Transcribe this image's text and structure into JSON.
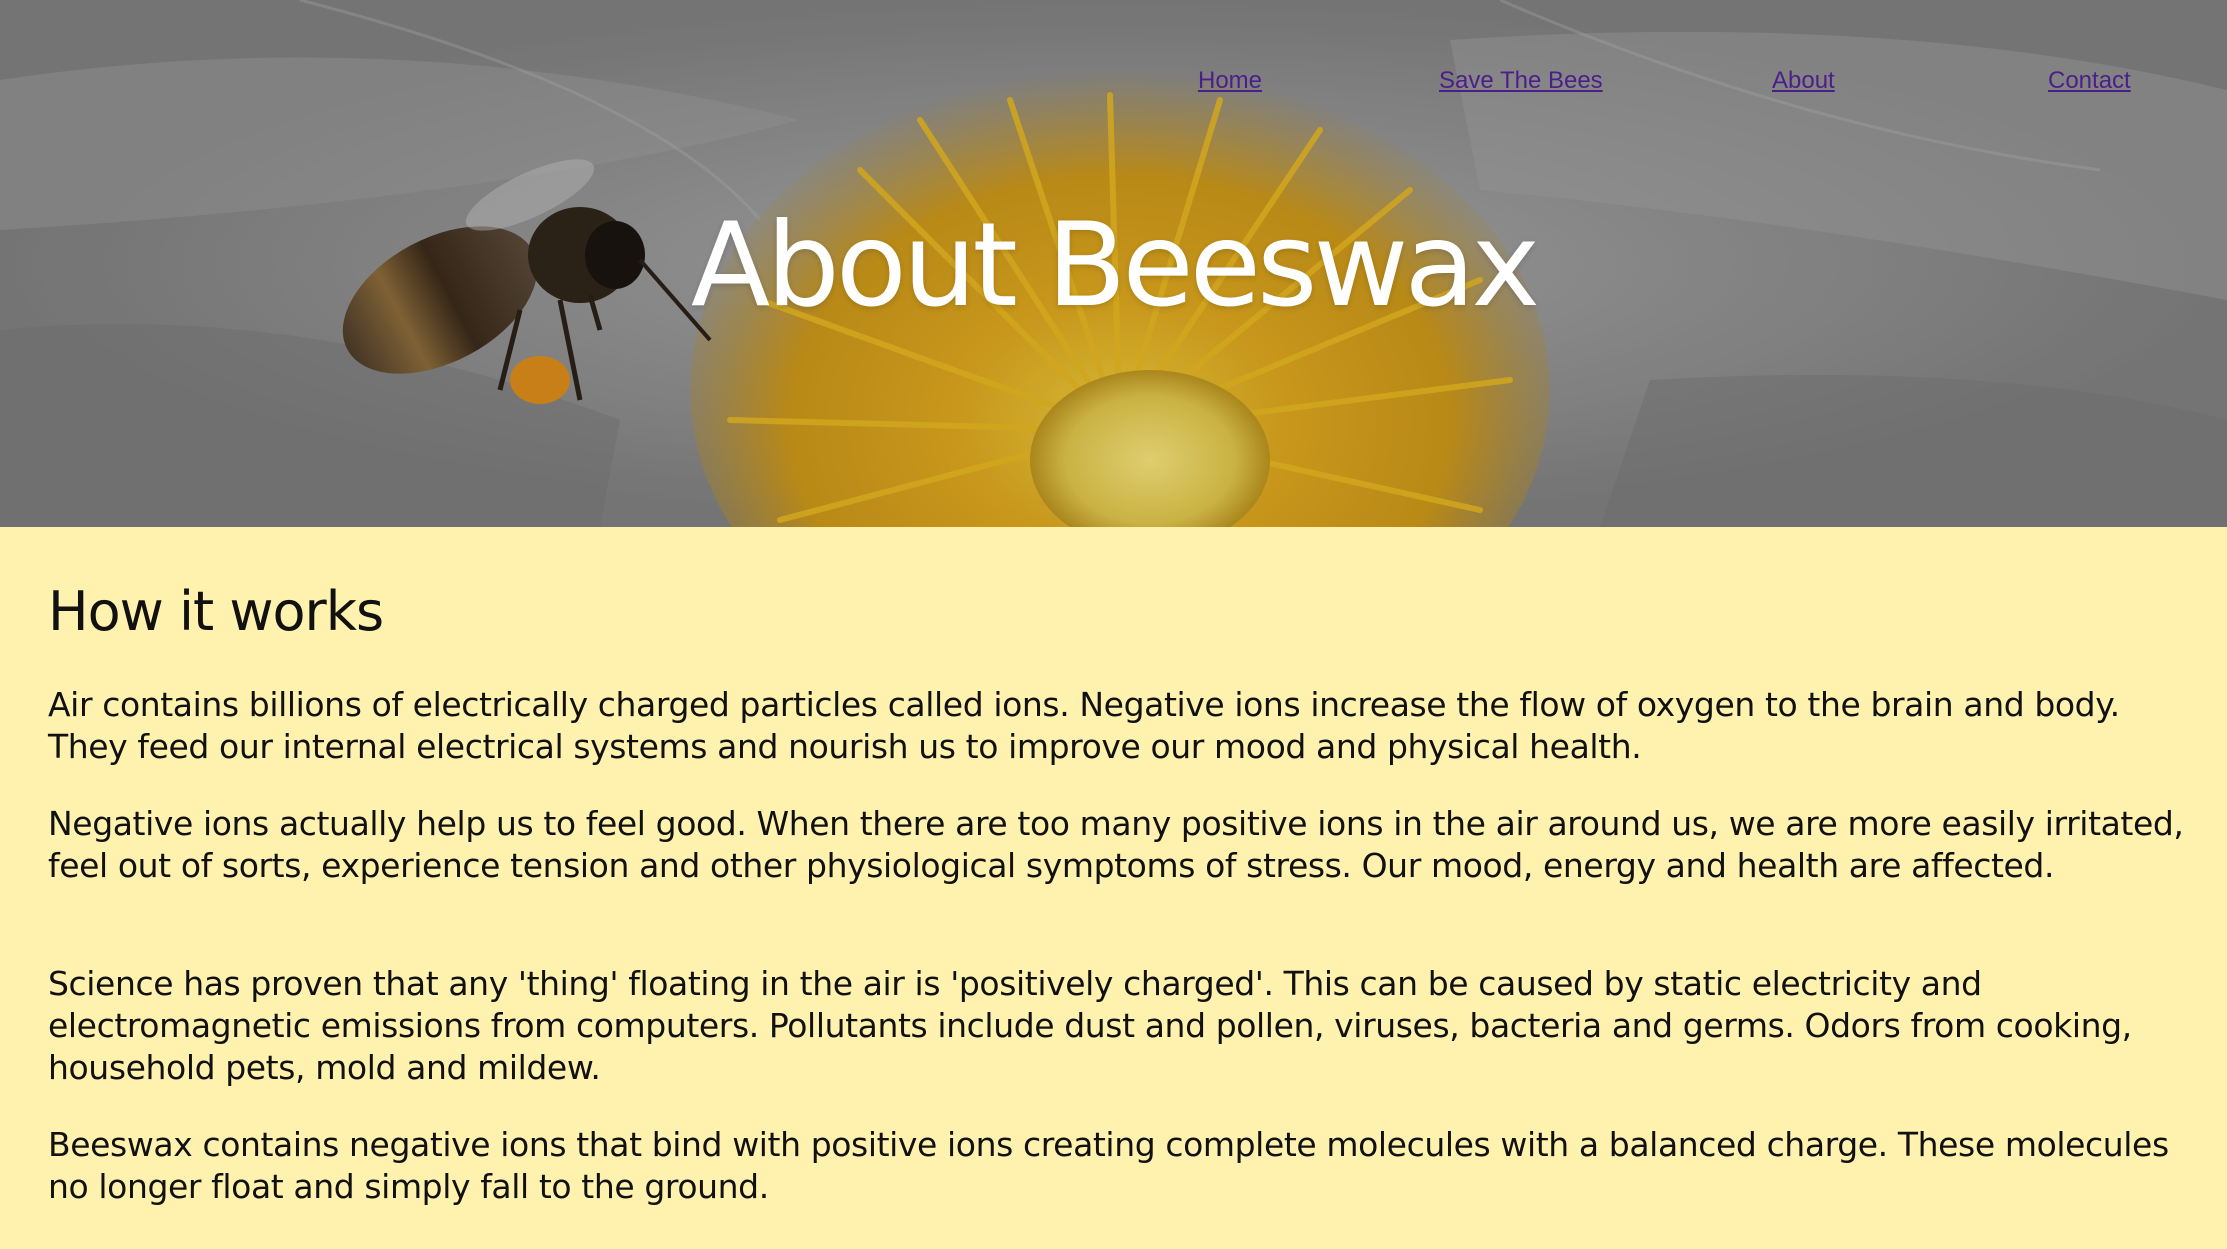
{
  "nav": {
    "home": "Home",
    "save_the_bees": "Save The Bees",
    "about": "About",
    "contact": "Contact"
  },
  "hero": {
    "title": "About Beeswax"
  },
  "section": {
    "heading": "How it works",
    "paragraphs": [
      "Air contains billions of electrically charged particles called ions. Negative ions increase the flow of oxygen to the brain and body. They feed our internal electrical systems and nourish us to improve our mood and physical health.",
      "Negative ions actually help us to feel good. When there are too many positive ions in the air around us, we are more easily irritated, feel out of sorts, experience tension and other physiological symptoms of stress. Our mood, energy and health are affected.",
      "Science has proven that any 'thing' floating in the air is 'positively charged'. This can be caused by static electricity and electromagnetic emissions from computers. Pollutants include dust and pollen, viruses, bacteria and germs. Odors from cooking, household pets, mold and mildew.",
      "Beeswax contains negative ions that bind with positive ions creating complete molecules with a balanced charge. These molecules no longer float and simply fall to the ground."
    ]
  },
  "colors": {
    "page_background": "#fff1ae",
    "nav_link": "#4b1f8a",
    "hero_title": "#ffffff",
    "body_text": "#111111"
  }
}
